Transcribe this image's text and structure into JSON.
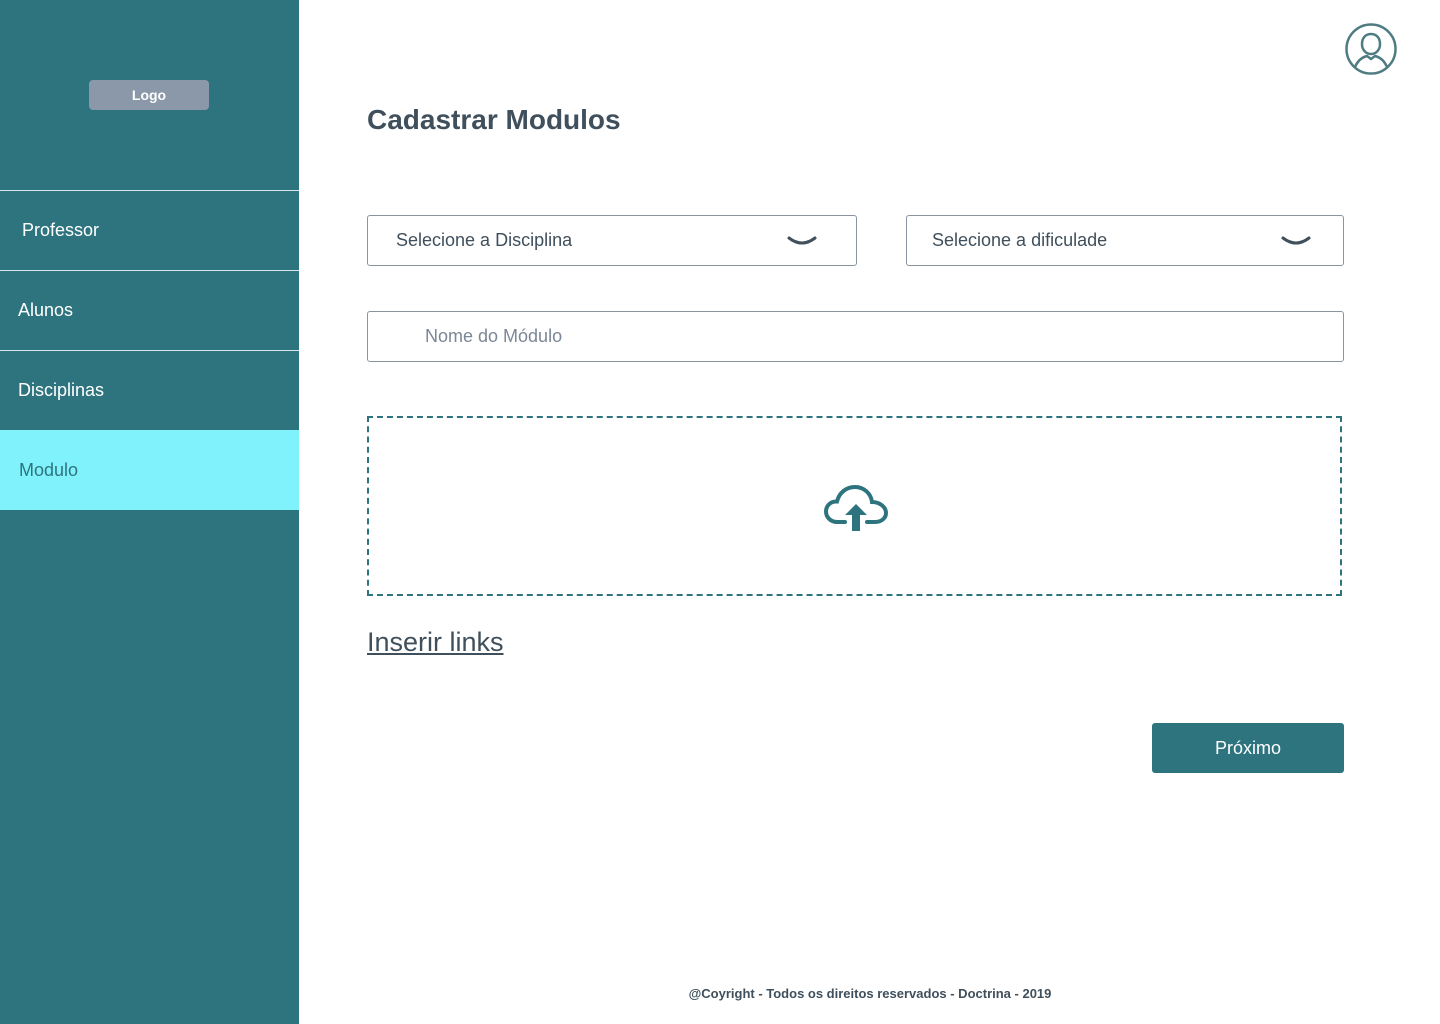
{
  "sidebar": {
    "logo_label": "Logo",
    "items": [
      {
        "label": "Professor"
      },
      {
        "label": "Alunos"
      },
      {
        "label": "Disciplinas"
      },
      {
        "label": "Modulo",
        "active": true
      }
    ]
  },
  "header": {
    "avatar_icon": "user-avatar-icon"
  },
  "main": {
    "title": "Cadastrar Modulos",
    "select_disciplina": "Selecione a Disciplina",
    "select_dificuldade": "Selecione a dificulade",
    "module_name_placeholder": "Nome do Módulo",
    "upload_icon": "cloud-upload-icon",
    "links_label": "Inserir links",
    "next_label": "Próximo"
  },
  "footer": {
    "text": "@Coyright - Todos os direitos reservados - Doctrina - 2019"
  },
  "colors": {
    "sidebar": "#2e747e",
    "active_item": "#80f2fb",
    "logo_bg": "#8a98aa",
    "text": "#3f4f5c"
  }
}
